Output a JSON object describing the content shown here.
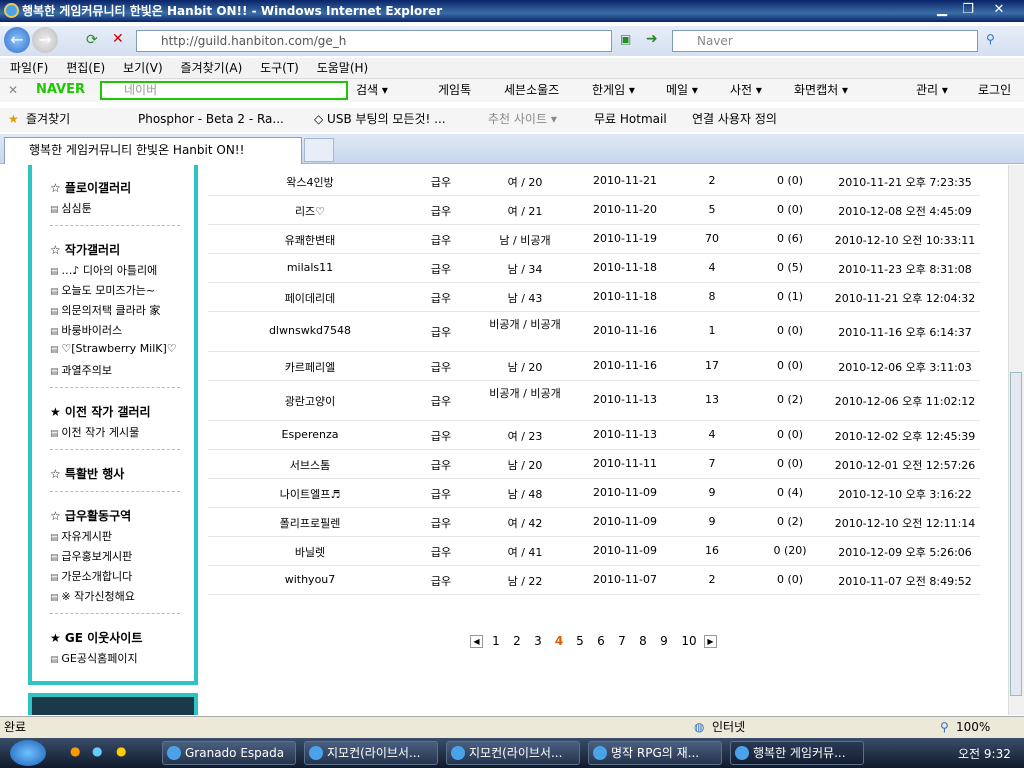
{
  "window": {
    "title": "행복한 게임커뮤니티 한빛온 Hanbit ON!! - Windows Internet Explorer"
  },
  "address": {
    "url": "http://guild.hanbiton.com/ge_h",
    "search_placeholder": "Naver"
  },
  "menu": [
    "파일(F)",
    "편집(E)",
    "보기(V)",
    "즐겨찾기(A)",
    "도구(T)",
    "도움말(H)"
  ],
  "toolbar": {
    "brand": "NAVER",
    "search_placeholder": "네이버",
    "items": [
      "검색 ▾",
      "게임톡",
      "세븐소울즈",
      "한게임 ▾",
      "메일 ▾",
      "사전 ▾",
      "화면캡처 ▾",
      "관리 ▾",
      "로그인"
    ]
  },
  "favorites": {
    "label": "즐겨찾기",
    "items": [
      "Phosphor - Beta 2 - Ra...",
      "◇ USB 부팅의 모든것! ...",
      "추천 사이트 ▾",
      "무료 Hotmail",
      "연결 사용자 정의"
    ]
  },
  "tab": {
    "title": "행복한 게임커뮤니티 한빛온 Hanbit ON!!"
  },
  "sidebar": {
    "heading_player": "☆ 플로이갤러리",
    "player_items": [
      "심심툰"
    ],
    "heading_artist": "☆ 작가갤러리",
    "artist_items": [
      "…♪ 디아의 아틀리에",
      "오늘도 모미즈가는~",
      "의문의저택 클라라 家",
      "바룽바이러스",
      "♡[Strawberry MilK]♡",
      "과열주의보"
    ],
    "heading_past": "★ 이전 작가 갤러리",
    "past_items": [
      "이전 작가 게시물"
    ],
    "heading_event": "☆ 특활반 행사",
    "heading_activity": "☆ 급우활동구역",
    "activity_items": [
      "자유게시판",
      "급우홍보게시판",
      "가문소개합니다",
      "※ 작가신청해요"
    ],
    "heading_neighbor": "★ GE 이웃사이트",
    "neighbor_items": [
      "GE공식홈페이지"
    ]
  },
  "rows": [
    [
      "왁스4인방",
      "급우",
      "여 / 20",
      "2010-11-21",
      "2",
      "0 (0)",
      "2010-11-21 오후 7:23:35"
    ],
    [
      "리즈♡",
      "급우",
      "여 / 21",
      "2010-11-20",
      "5",
      "0 (0)",
      "2010-12-08 오전 4:45:09"
    ],
    [
      "유쾌한변태",
      "급우",
      "남 / 비공개",
      "2010-11-19",
      "70",
      "0 (6)",
      "2010-12-10 오전 10:33:11"
    ],
    [
      "milals11",
      "급우",
      "남 / 34",
      "2010-11-18",
      "4",
      "0 (5)",
      "2010-11-23 오후 8:31:08"
    ],
    [
      "페이데리데",
      "급우",
      "남 / 43",
      "2010-11-18",
      "8",
      "0 (1)",
      "2010-11-21 오후 12:04:32"
    ],
    [
      "dlwnswkd7548",
      "급우",
      "비공개 / 비공개",
      "2010-11-16",
      "1",
      "0 (0)",
      "2010-11-16 오후 6:14:37"
    ],
    [
      "카르페리엘",
      "급우",
      "남 / 20",
      "2010-11-16",
      "17",
      "0 (0)",
      "2010-12-06 오후 3:11:03"
    ],
    [
      "광란고양이",
      "급우",
      "비공개 / 비공개",
      "2010-11-13",
      "13",
      "0 (2)",
      "2010-12-06 오후 11:02:12"
    ],
    [
      "Esperenza",
      "급우",
      "여 / 23",
      "2010-11-13",
      "4",
      "0 (0)",
      "2010-12-02 오후 12:45:39"
    ],
    [
      "서브스톰",
      "급우",
      "남 / 20",
      "2010-11-11",
      "7",
      "0 (0)",
      "2010-12-01 오전 12:57:26"
    ],
    [
      "나이트엘프♬",
      "급우",
      "남 / 48",
      "2010-11-09",
      "9",
      "0 (4)",
      "2010-12-10 오후 3:16:22"
    ],
    [
      "폴리프로필렌",
      "급우",
      "여 / 42",
      "2010-11-09",
      "9",
      "0 (2)",
      "2010-12-10 오전 12:11:14"
    ],
    [
      "바닐렛",
      "급우",
      "여 / 41",
      "2010-11-09",
      "16",
      "0 (20)",
      "2010-12-09 오후 5:26:06"
    ],
    [
      "withyou7",
      "급우",
      "남 / 22",
      "2010-11-07",
      "2",
      "0 (0)",
      "2010-11-07 오전 8:49:52"
    ]
  ],
  "pager": {
    "pages": [
      "1",
      "2",
      "3",
      "4",
      "5",
      "6",
      "7",
      "8",
      "9",
      "10"
    ],
    "current": "4"
  },
  "status": {
    "left": "완료",
    "zone": "인터넷",
    "zoom": "100%"
  },
  "taskbar": {
    "items": [
      "Granado Espada",
      "지모컨(라이브서...",
      "지모컨(라이브서...",
      "명작 RPG의 재...",
      "행복한 게임커뮤..."
    ],
    "clock": "오전 9:32"
  }
}
